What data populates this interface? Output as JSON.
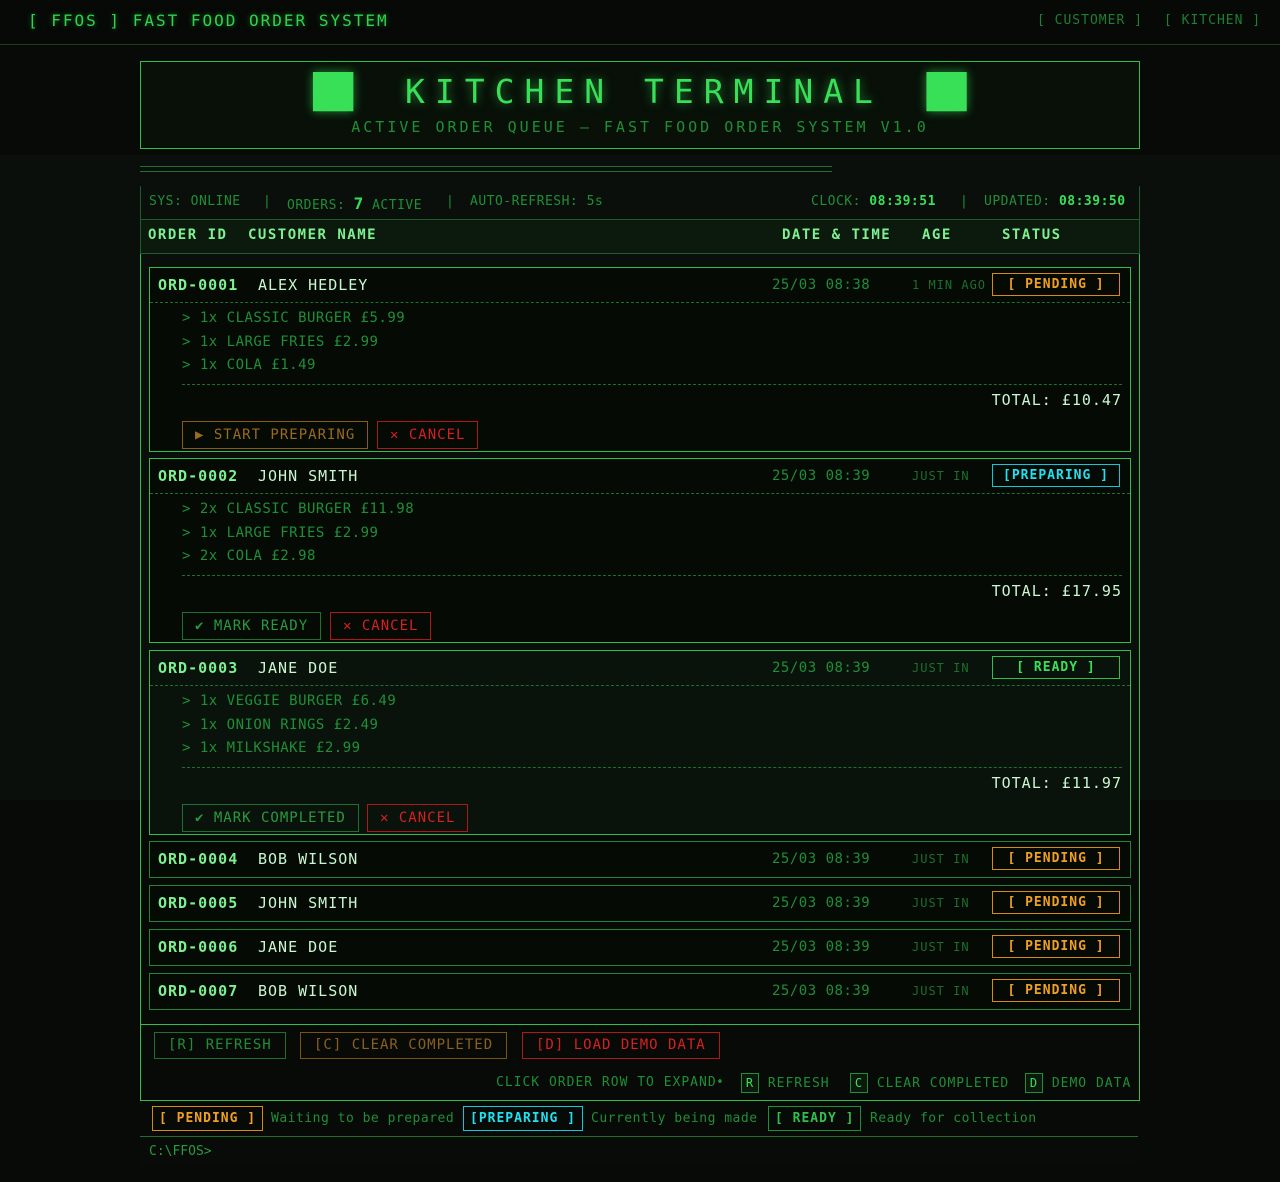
{
  "topbar": {
    "brand": "[ FFOS ] FAST FOOD ORDER SYSTEM",
    "nav": [
      "[ CUSTOMER ]",
      "[ KITCHEN ]"
    ]
  },
  "banner": {
    "left_block": "██",
    "title": "KITCHEN TERMINAL",
    "right_block": "██",
    "subtitle": "ACTIVE ORDER QUEUE — FAST FOOD ORDER SYSTEM V1.0"
  },
  "status": {
    "sys": "SYS: ONLINE",
    "sep": "|",
    "orders_label": "ORDERS:",
    "orders_count": "7",
    "orders_suffix": "ACTIVE",
    "auto_refresh": "AUTO-REFRESH: 5s",
    "clock_label": "CLOCK:",
    "clock": "08:39:51",
    "updated_label": "UPDATED:",
    "updated": "08:39:50"
  },
  "columns": {
    "order_id": "ORDER ID",
    "customer": "CUSTOMER NAME",
    "datetime": "DATE & TIME",
    "age": "AGE",
    "status": "STATUS"
  },
  "orders": [
    {
      "id": "ORD-0001",
      "customer": "ALEX HEDLEY",
      "datetime": "25/03 08:38",
      "age": "1 MIN AGO",
      "status": "[ PENDING ]",
      "items": [
        "> 1x CLASSIC BURGER £5.99",
        "> 1x LARGE FRIES £2.99",
        "> 1x COLA £1.49"
      ],
      "total": "TOTAL: £10.47",
      "actions": [
        "▶ START PREPARING",
        "✕ CANCEL"
      ]
    },
    {
      "id": "ORD-0002",
      "customer": "JOHN SMITH",
      "datetime": "25/03 08:39",
      "age": "JUST IN",
      "status": "[PREPARING ]",
      "items": [
        "> 2x CLASSIC BURGER £11.98",
        "> 1x LARGE FRIES £2.99",
        "> 2x COLA £2.98"
      ],
      "total": "TOTAL: £17.95",
      "actions": [
        "✔ MARK READY",
        "✕ CANCEL"
      ]
    },
    {
      "id": "ORD-0003",
      "customer": "JANE DOE",
      "datetime": "25/03 08:39",
      "age": "JUST IN",
      "status": "[ READY ]",
      "items": [
        "> 1x VEGGIE BURGER £6.49",
        "> 1x ONION RINGS £2.49",
        "> 1x MILKSHAKE £2.99"
      ],
      "total": "TOTAL: £11.97",
      "actions": [
        "✔ MARK COMPLETED",
        "✕ CANCEL"
      ]
    },
    {
      "id": "ORD-0004",
      "customer": "BOB WILSON",
      "datetime": "25/03 08:39",
      "age": "JUST IN",
      "status": "[ PENDING ]"
    },
    {
      "id": "ORD-0005",
      "customer": "JOHN SMITH",
      "datetime": "25/03 08:39",
      "age": "JUST IN",
      "status": "[ PENDING ]"
    },
    {
      "id": "ORD-0006",
      "customer": "JANE DOE",
      "datetime": "25/03 08:39",
      "age": "JUST IN",
      "status": "[ PENDING ]"
    },
    {
      "id": "ORD-0007",
      "customer": "BOB WILSON",
      "datetime": "25/03 08:39",
      "age": "JUST IN",
      "status": "[ PENDING ]"
    }
  ],
  "bottom": {
    "refresh": "[R] REFRESH",
    "clear": "[C] CLEAR COMPLETED",
    "demo": "[D] LOAD DEMO DATA",
    "hint": "CLICK ORDER ROW TO EXPAND",
    "bullet": "•",
    "key_r": "R",
    "key_r_label": "REFRESH",
    "key_c": "C",
    "key_c_label": "CLEAR COMPLETED",
    "key_d": "D",
    "key_d_label": "DEMO DATA"
  },
  "legend": {
    "pending": "[ PENDING ]",
    "pending_desc": "Waiting to be prepared",
    "preparing": "[PREPARING ]",
    "preparing_desc": "Currently being made",
    "ready": "[ READY ]",
    "ready_desc": "Ready for collection"
  },
  "prompt": "C:\\FFOS>",
  "colors": {
    "terminal_green": "#38e057",
    "pending_amber": "#f0a020",
    "preparing_cyan": "#22e0f0",
    "cancel_red": "#d82020"
  }
}
